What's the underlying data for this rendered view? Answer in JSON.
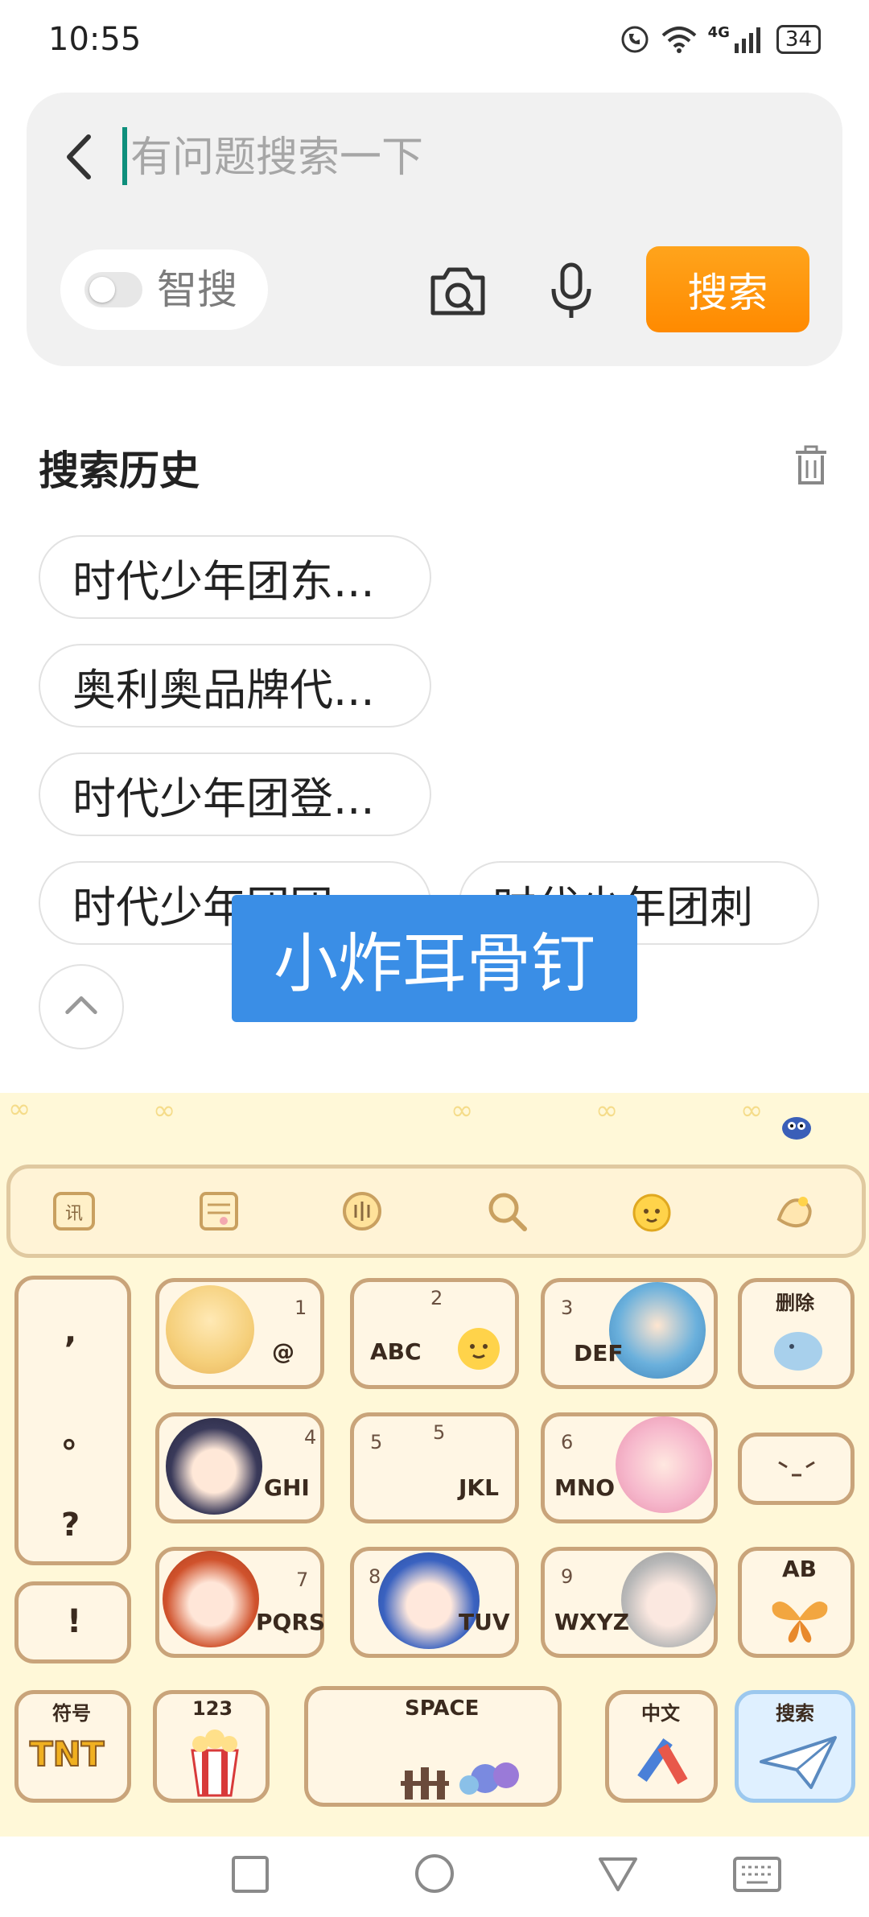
{
  "status_bar": {
    "time": "10:55",
    "network": "4G",
    "battery": "34"
  },
  "search": {
    "placeholder": "有问题搜索一下",
    "smart_search_label": "智搜",
    "search_button": "搜索"
  },
  "history": {
    "title": "搜索历史",
    "chips": [
      "时代少年团东...",
      "奥利奥品牌代...",
      "时代少年团登...",
      "时代少年团团...",
      "时代少年团刺"
    ]
  },
  "overlay_text": "小炸耳骨钉",
  "keyboard": {
    "punctuation": [
      ",",
      "。",
      "?",
      "!"
    ],
    "keys": [
      {
        "num": "1",
        "label": "@"
      },
      {
        "num": "2",
        "label": "ABC"
      },
      {
        "num": "3",
        "label": "DEF"
      },
      {
        "num": "4",
        "label": "GHI"
      },
      {
        "num": "5",
        "label": "JKL"
      },
      {
        "num": "6",
        "label": "MNO"
      },
      {
        "num": "7",
        "label": "PQRS"
      },
      {
        "num": "8",
        "label": "TUV"
      },
      {
        "num": "9",
        "label": "WXYZ"
      }
    ],
    "delete_label": "删除",
    "ab_label": "AB",
    "symbol_label": "符号",
    "tnt_label": "TNT",
    "num_label": "123",
    "space_label": "SPACE",
    "lang_label": "中文",
    "search_label": "搜索"
  },
  "colors": {
    "accent": "#ff8a00",
    "overlay": "#3a8ee6",
    "keyboard_bg": "#fff8d8",
    "key_border": "#c9a47a"
  }
}
